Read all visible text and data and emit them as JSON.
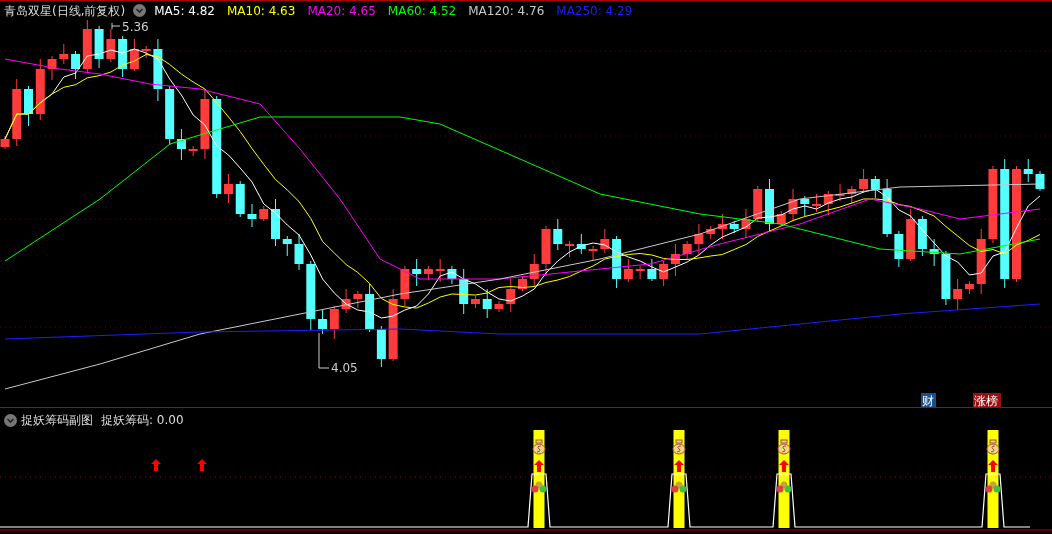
{
  "main_chart": {
    "title": "青岛双星(日线,前复权)",
    "ma_legend": [
      {
        "label": "MA5:",
        "value": "4.82",
        "color": "#ffffff"
      },
      {
        "label": "MA10:",
        "value": "4.63",
        "color": "#ffff00"
      },
      {
        "label": "MA20:",
        "value": "4.65",
        "color": "#ff00ff"
      },
      {
        "label": "MA60:",
        "value": "4.52",
        "color": "#00ff00"
      },
      {
        "label": "MA120:",
        "value": "4.76",
        "color": "#c8c8c8"
      },
      {
        "label": "MA250:",
        "value": "4.29",
        "color": "#1e1eff"
      }
    ],
    "high_label": "5.36",
    "low_label": "4.05",
    "badges": [
      {
        "text": "财",
        "color": "#1a4f8a"
      },
      {
        "text": "涨榜",
        "color": "#9a1010"
      }
    ]
  },
  "sub_chart": {
    "title": "捉妖筹码副图",
    "reading": "捉妖筹码: 0.00"
  }
}
